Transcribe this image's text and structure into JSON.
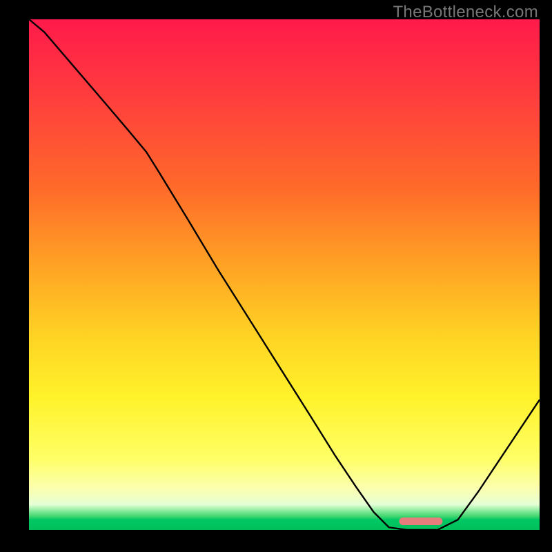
{
  "attribution": "TheBottleneck.com",
  "colors": {
    "gradient_top": "#ff1a4b",
    "gradient_bottom": "#00bf5a",
    "curve": "#000000",
    "marker": "#e67c7c",
    "background": "#000000",
    "attribution_text": "#777777"
  },
  "chart_data": {
    "type": "line",
    "title": "",
    "xlabel": "",
    "ylabel": "",
    "x_range": [
      0,
      1
    ],
    "y_range": [
      0,
      1
    ],
    "curve_points": [
      {
        "x": 0.0,
        "y": 1.0
      },
      {
        "x": 0.03,
        "y": 0.975
      },
      {
        "x": 0.09,
        "y": 0.905
      },
      {
        "x": 0.15,
        "y": 0.835
      },
      {
        "x": 0.195,
        "y": 0.782
      },
      {
        "x": 0.23,
        "y": 0.74
      },
      {
        "x": 0.255,
        "y": 0.7
      },
      {
        "x": 0.31,
        "y": 0.61
      },
      {
        "x": 0.37,
        "y": 0.51
      },
      {
        "x": 0.43,
        "y": 0.415
      },
      {
        "x": 0.49,
        "y": 0.32
      },
      {
        "x": 0.55,
        "y": 0.225
      },
      {
        "x": 0.6,
        "y": 0.145
      },
      {
        "x": 0.64,
        "y": 0.085
      },
      {
        "x": 0.675,
        "y": 0.035
      },
      {
        "x": 0.705,
        "y": 0.005
      },
      {
        "x": 0.74,
        "y": 0.0
      },
      {
        "x": 0.8,
        "y": 0.0
      },
      {
        "x": 0.84,
        "y": 0.02
      },
      {
        "x": 0.88,
        "y": 0.075
      },
      {
        "x": 0.92,
        "y": 0.135
      },
      {
        "x": 0.96,
        "y": 0.195
      },
      {
        "x": 1.0,
        "y": 0.255
      }
    ],
    "optimal_range": {
      "x_start": 0.725,
      "x_end": 0.81,
      "y": 0.0
    },
    "note": "y=0 is the bottom green band (best), y=1 is the top red (worst). x is an unlabeled horizontal axis (likely resolution or config index)."
  }
}
